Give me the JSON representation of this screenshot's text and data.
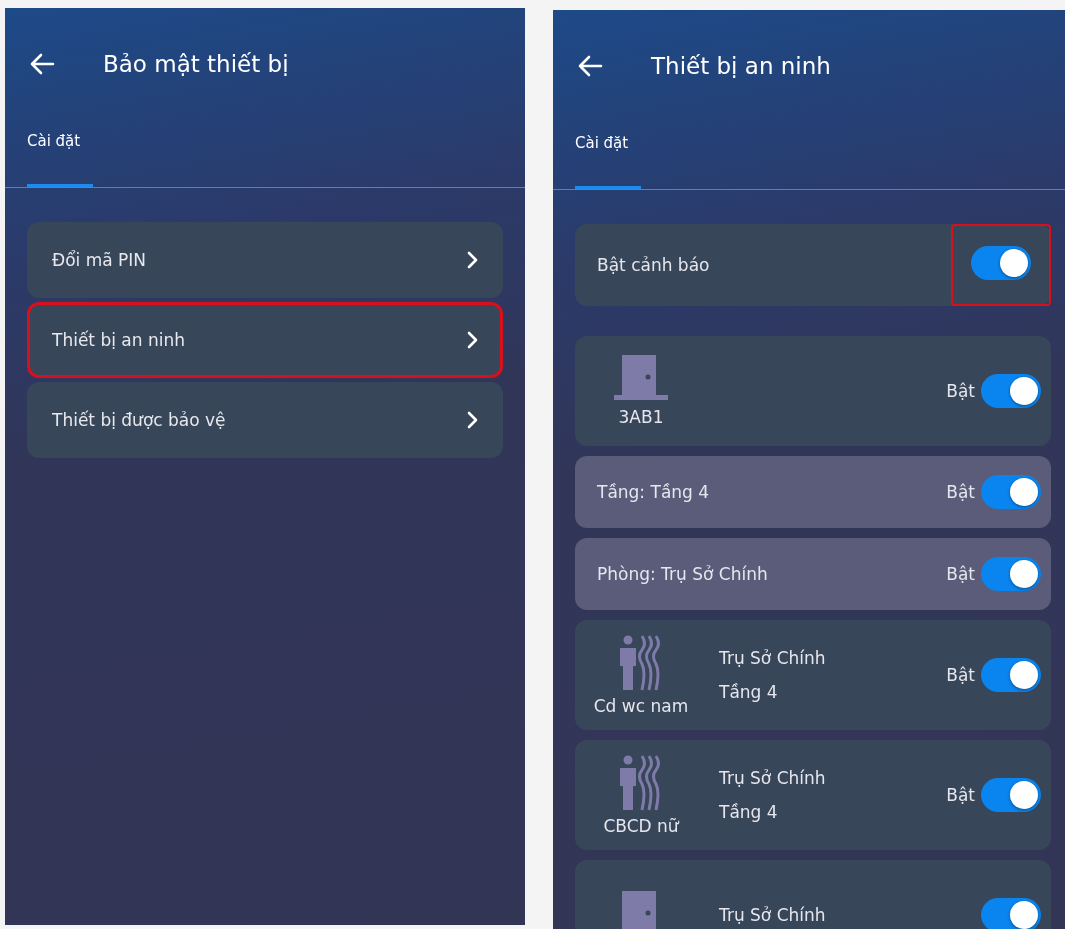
{
  "screens": [
    {
      "title": "Bảo mật thiết bị",
      "tabs": [
        {
          "label": "Cài đặt",
          "selected": true
        }
      ],
      "menu": [
        {
          "label": "Đổi mã PIN",
          "highlighted": false
        },
        {
          "label": "Thiết bị an ninh",
          "highlighted": true
        },
        {
          "label": "Thiết bị được bảo vệ",
          "highlighted": false
        }
      ]
    },
    {
      "title": "Thiết bị an ninh",
      "tabs": [
        {
          "label": "Cài đặt",
          "selected": true
        }
      ],
      "alert": {
        "label": "Bật cảnh báo",
        "on": true,
        "highlighted": true
      },
      "items": [
        {
          "kind": "door",
          "name": "3AB1",
          "state_label": "Bật",
          "on": true
        },
        {
          "kind": "group",
          "label": "Tầng: Tầng 4",
          "state_label": "Bật",
          "on": true
        },
        {
          "kind": "group",
          "label": "Phòng: Trụ Sở Chính",
          "state_label": "Bật",
          "on": true
        },
        {
          "kind": "motion",
          "name": "Cd wc nam",
          "location": [
            "Trụ Sở Chính",
            "Tầng 4"
          ],
          "state_label": "Bật",
          "on": true
        },
        {
          "kind": "motion",
          "name": "CBCD nữ",
          "location": [
            "Trụ Sở Chính",
            "Tầng 4"
          ],
          "state_label": "Bật",
          "on": true
        },
        {
          "kind": "door",
          "location": [
            "Trụ Sở Chính"
          ],
          "on": true
        }
      ]
    }
  ]
}
